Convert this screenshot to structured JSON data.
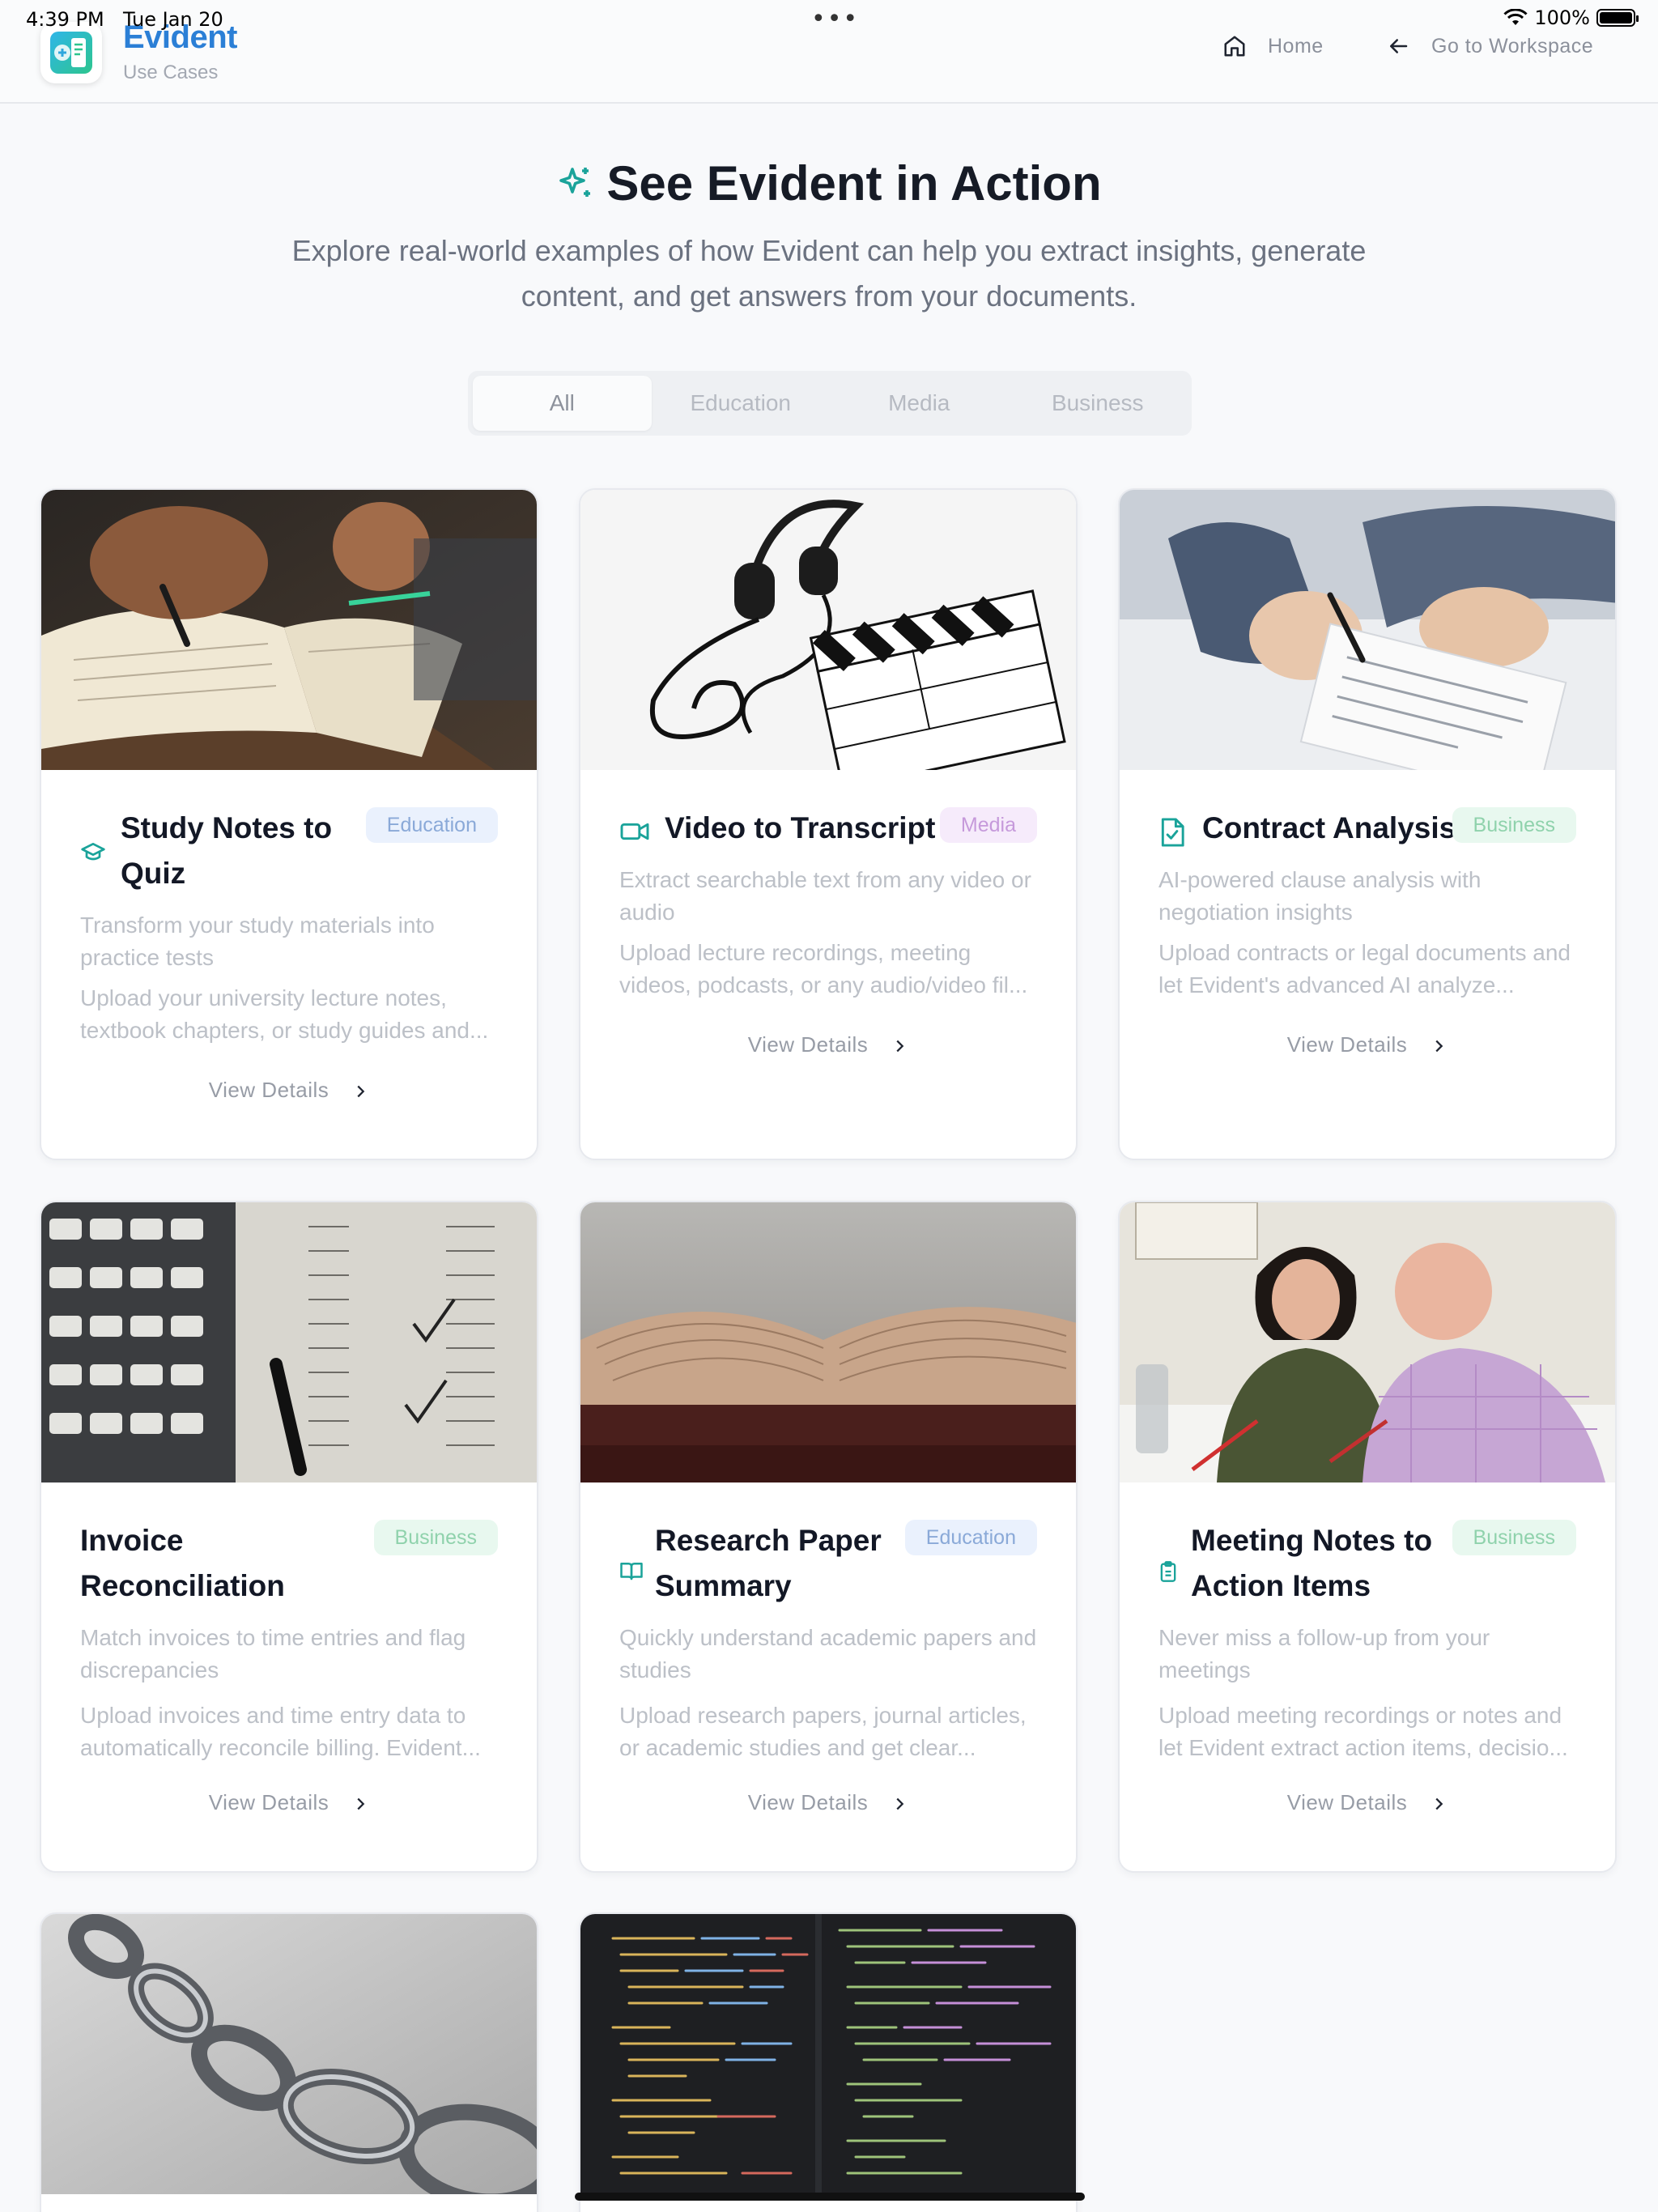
{
  "status_bar": {
    "time": "4:39 PM",
    "date": "Tue Jan 20",
    "battery": "100%",
    "battery_level": 1.0
  },
  "header": {
    "brand": "Evident",
    "subtitle": "Use Cases",
    "nav_home": "Home",
    "nav_workspace": "Go to Workspace"
  },
  "hero": {
    "title": "See Evident in Action",
    "description": "Explore real-world examples of how Evident can help you extract insights, generate content, and get answers from your documents."
  },
  "tabs": [
    {
      "label": "All",
      "active": true
    },
    {
      "label": "Education",
      "active": false
    },
    {
      "label": "Media",
      "active": false
    },
    {
      "label": "Business",
      "active": false
    }
  ],
  "view_details_label": "View Details",
  "cards": [
    {
      "title": "Study Notes to Quiz",
      "category": "Education",
      "icon": "graduation-cap-icon",
      "summary": "Transform your study materials into practice tests",
      "description": "Upload your university lecture notes, textbook chapters, or study guides and..."
    },
    {
      "title": "Video to Transcript",
      "category": "Media",
      "icon": "video-camera-icon",
      "summary": "Extract searchable text from any video or audio",
      "description": "Upload lecture recordings, meeting videos, podcasts, or any audio/video fil..."
    },
    {
      "title": "Contract Analysis",
      "category": "Business",
      "icon": "file-check-icon",
      "summary": "AI-powered clause analysis with negotiation insights",
      "description": "Upload contracts or legal documents and let Evident's advanced AI analyze..."
    },
    {
      "title": "Invoice Reconciliation",
      "category": "Business",
      "icon": "",
      "summary": "Match invoices to time entries and flag discrepancies",
      "description": "Upload invoices and time entry data to automatically reconcile billing. Evident..."
    },
    {
      "title": "Research Paper Summary",
      "category": "Education",
      "icon": "open-book-icon",
      "summary": "Quickly understand academic papers and studies",
      "description": "Upload research papers, journal articles, or academic studies and get clear..."
    },
    {
      "title": "Meeting Notes to Action Items",
      "category": "Business",
      "icon": "clipboard-icon",
      "summary": "Never miss a follow-up from your meetings",
      "description": "Upload meeting recordings or notes and let Evident extract action items, decisio..."
    }
  ]
}
